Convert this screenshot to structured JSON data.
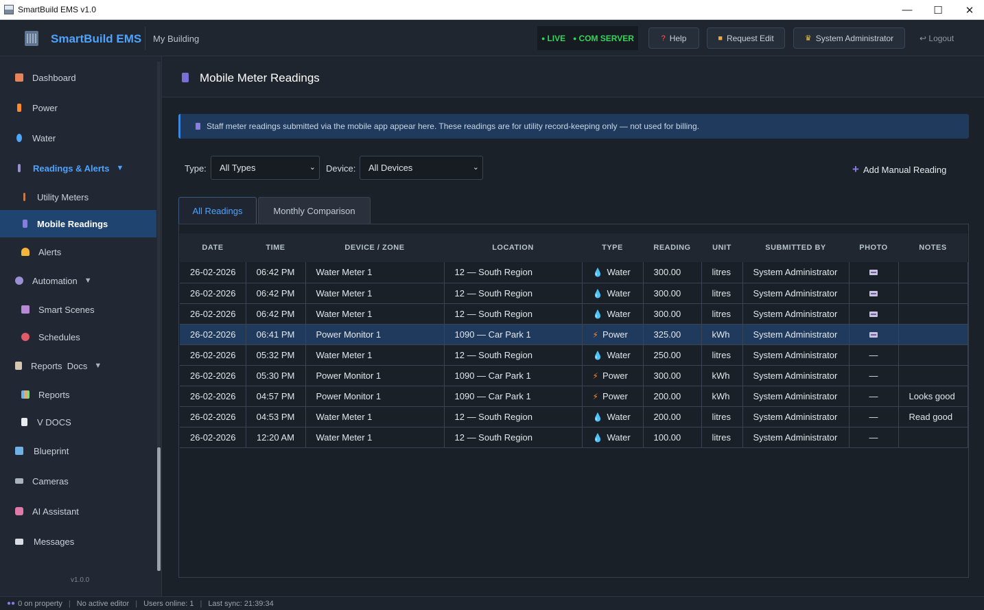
{
  "window": {
    "title": "SmartBuild EMS v1.0",
    "minimize": "—",
    "maximize": "☐",
    "close": "✕"
  },
  "header": {
    "brand": "SmartBuild EMS",
    "building": "My Building",
    "live": "LIVE",
    "com_server": "COM SERVER",
    "help": "Help",
    "request_edit": "Request Edit",
    "user": "System Administrator",
    "logout": "Logout"
  },
  "sidebar": {
    "items": [
      {
        "label": "Dashboard",
        "icon": "house-icon",
        "color": "#e8825a"
      },
      {
        "label": "Power",
        "icon": "bolt-icon",
        "color": "#ff8a2a"
      },
      {
        "label": "Water",
        "icon": "droplet-icon",
        "color": "#4fa8ff"
      },
      {
        "label": "Readings & Alerts",
        "icon": "gauge-icon",
        "color": "#9a8fd0"
      },
      {
        "label": "Utility Meters",
        "icon": "thermometer-icon",
        "color": "#c77b4a"
      },
      {
        "label": "Mobile Readings",
        "icon": "phone-icon",
        "color": "#8a7be0"
      },
      {
        "label": "Alerts",
        "icon": "bell-icon",
        "color": "#f5b43a"
      },
      {
        "label": "Automation",
        "icon": "gear-icon",
        "color": "#9a8fd0"
      },
      {
        "label": "Smart Scenes",
        "icon": "scene-icon",
        "color": "#b78ad6"
      },
      {
        "label": "Schedules",
        "icon": "clock-icon",
        "color": "#e05a6a"
      },
      {
        "label": "Reports  Docs",
        "icon": "clipboard-icon",
        "color": "#d6c7b0"
      },
      {
        "label": "Reports",
        "icon": "bar-chart-icon",
        "color": "#6fb0e6"
      },
      {
        "label": "V DOCS",
        "icon": "document-icon",
        "color": "#e9ecef"
      },
      {
        "label": "Blueprint",
        "icon": "map-icon",
        "color": "#6fb0e6"
      },
      {
        "label": "Cameras",
        "icon": "camera-icon",
        "color": "#aab4bf"
      },
      {
        "label": "AI Assistant",
        "icon": "robot-icon",
        "color": "#e07aa8"
      },
      {
        "label": "Messages",
        "icon": "mail-icon",
        "color": "#d9dde3"
      }
    ],
    "version": "v1.0.0"
  },
  "page": {
    "title": "Mobile Meter Readings",
    "info": "Staff meter readings submitted via the mobile app appear here.  These readings are for utility record-keeping only — not used for billing."
  },
  "filters": {
    "type_label": "Type:",
    "type_value": "All Types",
    "device_label": "Device:",
    "device_value": "All Devices",
    "add_button": "Add Manual Reading"
  },
  "tabs": [
    {
      "label": "All Readings"
    },
    {
      "label": "Monthly Comparison"
    }
  ],
  "table": {
    "headers": [
      "DATE",
      "TIME",
      "DEVICE / ZONE",
      "LOCATION",
      "TYPE",
      "READING",
      "UNIT",
      "SUBMITTED BY",
      "PHOTO",
      "NOTES"
    ],
    "rows": [
      {
        "date": "26-02-2026",
        "time": "06:42 PM",
        "device": "Water Meter 1",
        "location": "12 — South Region",
        "type": "Water",
        "reading": "300.00",
        "unit": "litres",
        "by": "System Administrator",
        "photo": "photo-icon",
        "notes": ""
      },
      {
        "date": "26-02-2026",
        "time": "06:42 PM",
        "device": "Water Meter 1",
        "location": "12 — South Region",
        "type": "Water",
        "reading": "300.00",
        "unit": "litres",
        "by": "System Administrator",
        "photo": "photo-icon",
        "notes": ""
      },
      {
        "date": "26-02-2026",
        "time": "06:42 PM",
        "device": "Water Meter 1",
        "location": "12 — South Region",
        "type": "Water",
        "reading": "300.00",
        "unit": "litres",
        "by": "System Administrator",
        "photo": "photo-icon",
        "notes": ""
      },
      {
        "date": "26-02-2026",
        "time": "06:41 PM",
        "device": "Power Monitor 1",
        "location": "1090 — Car Park 1",
        "type": "Power",
        "reading": "325.00",
        "unit": "kWh",
        "by": "System Administrator",
        "photo": "photo-icon",
        "notes": ""
      },
      {
        "date": "26-02-2026",
        "time": "05:32 PM",
        "device": "Water Meter 1",
        "location": "12 — South Region",
        "type": "Water",
        "reading": "250.00",
        "unit": "litres",
        "by": "System Administrator",
        "photo": "—",
        "notes": ""
      },
      {
        "date": "26-02-2026",
        "time": "05:30 PM",
        "device": "Power Monitor 1",
        "location": "1090 — Car Park 1",
        "type": "Power",
        "reading": "300.00",
        "unit": "kWh",
        "by": "System Administrator",
        "photo": "—",
        "notes": ""
      },
      {
        "date": "26-02-2026",
        "time": "04:57 PM",
        "device": "Power Monitor 1",
        "location": "1090 — Car Park 1",
        "type": "Power",
        "reading": "200.00",
        "unit": "kWh",
        "by": "System Administrator",
        "photo": "—",
        "notes": "Looks good"
      },
      {
        "date": "26-02-2026",
        "time": "04:53 PM",
        "device": "Water Meter 1",
        "location": "12 — South Region",
        "type": "Water",
        "reading": "200.00",
        "unit": "litres",
        "by": "System Administrator",
        "photo": "—",
        "notes": "Read good"
      },
      {
        "date": "26-02-2026",
        "time": "12:20 AM",
        "device": "Water Meter 1",
        "location": "12 — South Region",
        "type": "Water",
        "reading": "100.00",
        "unit": "litres",
        "by": "System Administrator",
        "photo": "—",
        "notes": ""
      }
    ]
  },
  "status": {
    "on_property": "0 on property",
    "editor": "No active editor",
    "users": "Users online: 1",
    "sync": "Last sync: 21:39:34"
  },
  "colors": {
    "accent": "#4ea3ff",
    "live": "#36d35a",
    "selected_row": "#1f3a5c",
    "water": "#4fa8ff",
    "power": "#ff8a2a"
  }
}
